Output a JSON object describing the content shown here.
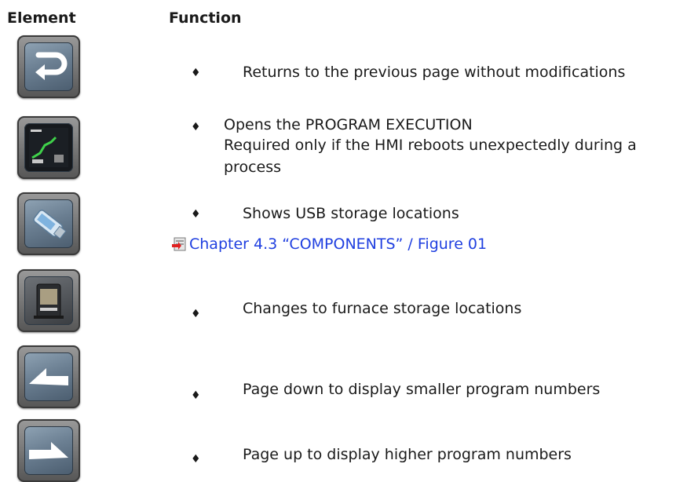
{
  "headers": {
    "element": "Element",
    "function": "Function"
  },
  "bullet_symbol": "♦",
  "rows": [
    {
      "icon": "return-arrow-icon",
      "text": "Returns to the previous page without modifications"
    },
    {
      "icon": "program-execution-icon",
      "lines": [
        "Opens the PROGRAM EXECUTION",
        "Required only if the HMI reboots unexpectedly during a",
        "process"
      ]
    },
    {
      "icon": "usb-stick-icon",
      "text": "Shows USB storage locations",
      "link": "Chapter 4.3 “COMPONENTS” / Figure 01"
    },
    {
      "icon": "furnace-icon",
      "text": "Changes to furnace storage locations"
    },
    {
      "icon": "page-down-arrow-icon",
      "text": "Page down to display smaller program numbers"
    },
    {
      "icon": "page-up-arrow-icon",
      "text": "Page up to display higher program numbers"
    }
  ],
  "colors": {
    "link": "#1f3fe0",
    "button_face": "#6b7f92"
  }
}
